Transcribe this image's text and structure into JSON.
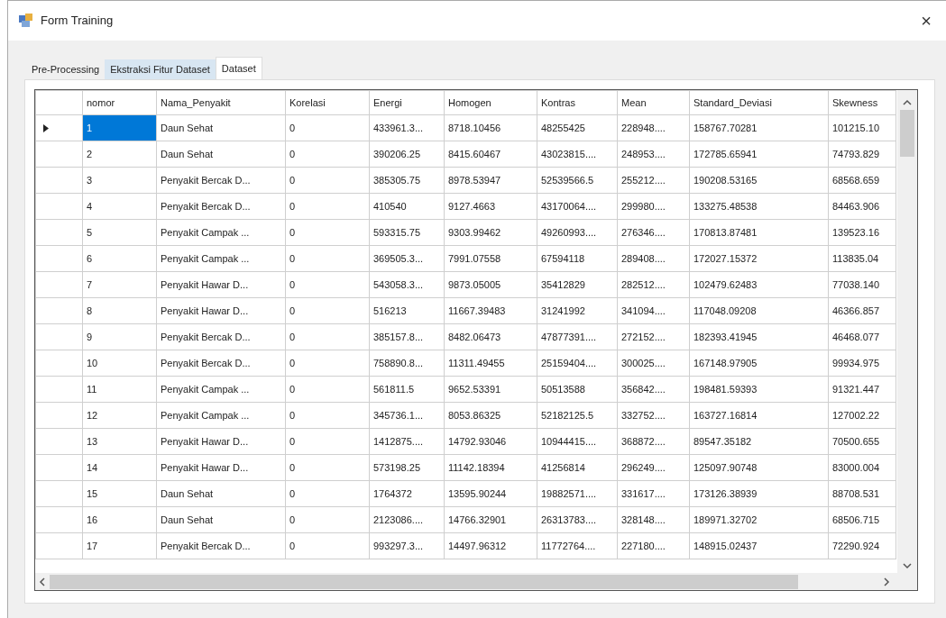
{
  "window": {
    "title": "Form Training",
    "close": "×"
  },
  "tabs": [
    {
      "label": "Pre-Processing",
      "selected": false,
      "hovered": false
    },
    {
      "label": "Ekstraksi Fitur Dataset",
      "selected": false,
      "hovered": true
    },
    {
      "label": "Dataset",
      "selected": true,
      "hovered": false
    }
  ],
  "table": {
    "columns": [
      "nomor",
      "Nama_Penyakit",
      "Korelasi",
      "Energi",
      "Homogen",
      "Kontras",
      "Mean",
      "Standard_Deviasi",
      "Skewness"
    ],
    "rows": [
      {
        "selected": true,
        "cells": [
          "1",
          "Daun Sehat",
          "0",
          "433961.3...",
          "8718.10456",
          "48255425",
          "228948....",
          "158767.70281",
          "101215.10"
        ]
      },
      {
        "selected": false,
        "cells": [
          "2",
          "Daun Sehat",
          "0",
          "390206.25",
          "8415.60467",
          "43023815....",
          "248953....",
          "172785.65941",
          "74793.829"
        ]
      },
      {
        "selected": false,
        "cells": [
          "3",
          "Penyakit Bercak D...",
          "0",
          "385305.75",
          "8978.53947",
          "52539566.5",
          "255212....",
          "190208.53165",
          "68568.659"
        ]
      },
      {
        "selected": false,
        "cells": [
          "4",
          "Penyakit Bercak D...",
          "0",
          "410540",
          "9127.4663",
          "43170064....",
          "299980....",
          "133275.48538",
          "84463.906"
        ]
      },
      {
        "selected": false,
        "cells": [
          "5",
          "Penyakit Campak ...",
          "0",
          "593315.75",
          "9303.99462",
          "49260993....",
          "276346....",
          "170813.87481",
          "139523.16"
        ]
      },
      {
        "selected": false,
        "cells": [
          "6",
          "Penyakit Campak ...",
          "0",
          "369505.3...",
          "7991.07558",
          "67594118",
          "289408....",
          "172027.15372",
          "113835.04"
        ]
      },
      {
        "selected": false,
        "cells": [
          "7",
          "Penyakit Hawar D...",
          "0",
          "543058.3...",
          "9873.05005",
          "35412829",
          "282512....",
          "102479.62483",
          "77038.140"
        ]
      },
      {
        "selected": false,
        "cells": [
          "8",
          "Penyakit Hawar D...",
          "0",
          "516213",
          "11667.39483",
          "31241992",
          "341094....",
          "117048.09208",
          "46366.857"
        ]
      },
      {
        "selected": false,
        "cells": [
          "9",
          "Penyakit Bercak D...",
          "0",
          "385157.8...",
          "8482.06473",
          "47877391....",
          "272152....",
          "182393.41945",
          "46468.077"
        ]
      },
      {
        "selected": false,
        "cells": [
          "10",
          "Penyakit Bercak D...",
          "0",
          "758890.8...",
          "11311.49455",
          "25159404....",
          "300025....",
          "167148.97905",
          "99934.975"
        ]
      },
      {
        "selected": false,
        "cells": [
          "11",
          "Penyakit Campak ...",
          "0",
          "561811.5",
          "9652.53391",
          "50513588",
          "356842....",
          "198481.59393",
          "91321.447"
        ]
      },
      {
        "selected": false,
        "cells": [
          "12",
          "Penyakit Campak ...",
          "0",
          "345736.1...",
          "8053.86325",
          "52182125.5",
          "332752....",
          "163727.16814",
          "127002.22"
        ]
      },
      {
        "selected": false,
        "cells": [
          "13",
          "Penyakit Hawar D...",
          "0",
          "1412875....",
          "14792.93046",
          "10944415....",
          "368872....",
          "89547.35182",
          "70500.655"
        ]
      },
      {
        "selected": false,
        "cells": [
          "14",
          "Penyakit Hawar D...",
          "0",
          "573198.25",
          "11142.18394",
          "41256814",
          "296249....",
          "125097.90748",
          "83000.004"
        ]
      },
      {
        "selected": false,
        "cells": [
          "15",
          "Daun Sehat",
          "0",
          "1764372",
          "13595.90244",
          "19882571....",
          "331617....",
          "173126.38939",
          "88708.531"
        ]
      },
      {
        "selected": false,
        "cells": [
          "16",
          "Daun Sehat",
          "0",
          "2123086....",
          "14766.32901",
          "26313783....",
          "328148....",
          "189971.32702",
          "68506.715"
        ]
      },
      {
        "selected": false,
        "cells": [
          "17",
          "Penyakit Bercak D...",
          "0",
          "993297.3...",
          "14497.96312",
          "11772764....",
          "227180....",
          "148915.02437",
          "72290.924"
        ]
      }
    ]
  }
}
